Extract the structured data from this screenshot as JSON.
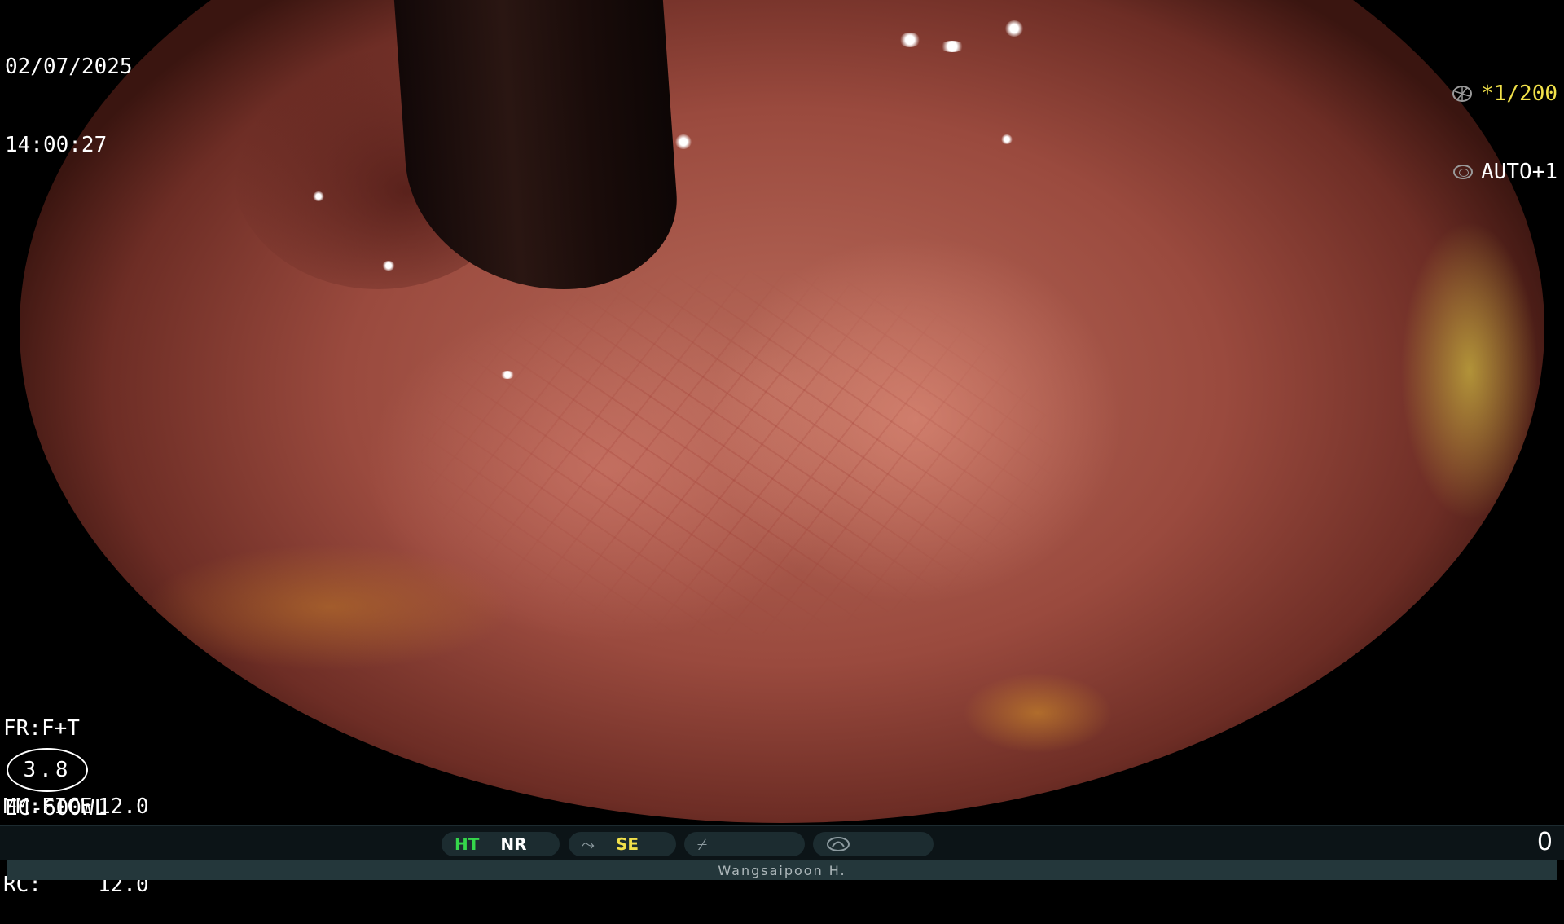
{
  "overlay": {
    "date": "02/07/2025",
    "time": "14:00:27",
    "shutter": "*1/200",
    "exposure": "AUTO+1",
    "fr": "FR:F+T",
    "mm": "MM:FICE",
    "rc": "RC:",
    "scope_number": "3.8",
    "scope_val_1": "12.0",
    "scope_val_2": "12.0",
    "scope_model": "EC-600WL"
  },
  "statusbar": {
    "ht": "HT",
    "nr": "NR",
    "se": "SE",
    "counter": "0",
    "operator": "Wangsaipoon H."
  },
  "colors": {
    "accent_green": "#35d64b",
    "accent_yellow": "#f1e04a",
    "bar_bg": "#0c1417"
  },
  "icons": {
    "shutter": "aperture-icon",
    "exposure": "ring-icon",
    "structure": "tilde-arrow-icon",
    "color": "slash-icon",
    "light": "lamp-icon"
  }
}
